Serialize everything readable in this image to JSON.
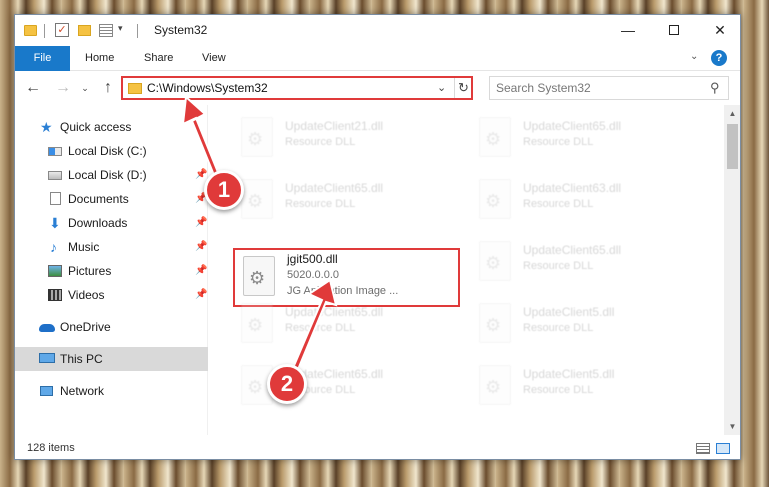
{
  "window": {
    "title": "System32",
    "controls": {
      "minimize": "—",
      "maximize": "",
      "close": "✕"
    }
  },
  "ribbon": {
    "tabs": [
      "File",
      "Home",
      "Share",
      "View"
    ],
    "help": "?"
  },
  "address_bar": {
    "path": "C:\\Windows\\System32",
    "search_placeholder": "Search System32"
  },
  "nav_pane": {
    "items": [
      {
        "label": "Quick access",
        "icon": "star-icon",
        "pinned": false
      },
      {
        "label": "Local Disk (C:)",
        "icon": "drive-icon",
        "pinned": false
      },
      {
        "label": "Local Disk (D:)",
        "icon": "drive-icon",
        "pinned": true
      },
      {
        "label": "Documents",
        "icon": "documents-icon",
        "pinned": true
      },
      {
        "label": "Downloads",
        "icon": "downloads-icon",
        "pinned": true
      },
      {
        "label": "Music",
        "icon": "music-icon",
        "pinned": true
      },
      {
        "label": "Pictures",
        "icon": "pictures-icon",
        "pinned": true
      },
      {
        "label": "Videos",
        "icon": "videos-icon",
        "pinned": true
      },
      {
        "label": "OneDrive",
        "icon": "onedrive-icon",
        "pinned": false
      },
      {
        "label": "This PC",
        "icon": "this-pc-icon",
        "pinned": false,
        "selected": true
      },
      {
        "label": "Network",
        "icon": "network-icon",
        "pinned": false
      }
    ]
  },
  "files": [
    {
      "name": "UpdateClient21.dll",
      "desc": "Resource DLL"
    },
    {
      "name": "UpdateClient65.dll",
      "desc": "Resource DLL"
    },
    {
      "name": "UpdateClient65.dll",
      "desc": "Resource DLL"
    },
    {
      "name": "UpdateClient63.dll",
      "desc": "Resource DLL"
    },
    {
      "name": "jgit500.dll",
      "version": "5020.0.0.0",
      "desc": "JG Animation Image ..."
    },
    {
      "name": "UpdateClient65.dll",
      "desc": "Resource DLL"
    },
    {
      "name": "UpdateClient65.dll",
      "desc": "Resource DLL"
    },
    {
      "name": "UpdateClient5.dll",
      "desc": "Resource DLL"
    },
    {
      "name": "UpdateClient65.dll",
      "desc": "Resource DLL"
    },
    {
      "name": "UpdateClient5.dll",
      "desc": "Resource DLL"
    }
  ],
  "status": {
    "item_count": "128 items"
  },
  "annotations": {
    "step1": "1",
    "step2": "2",
    "color": "#e03a3a"
  }
}
